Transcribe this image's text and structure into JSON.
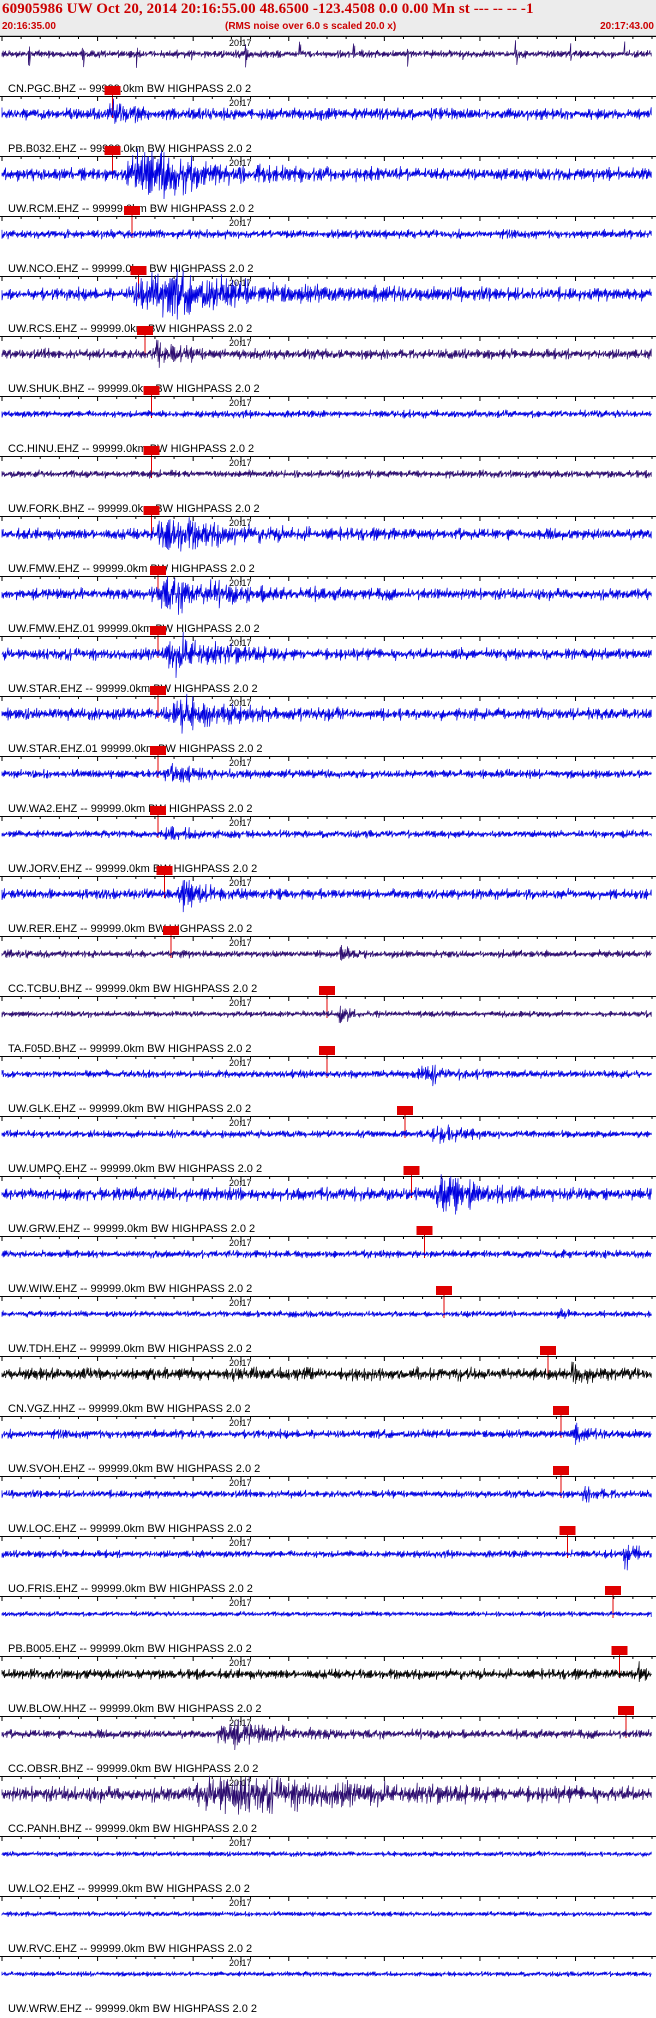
{
  "header": {
    "title": "60905986 UW Oct 20, 2014 20:16:55.00   48.6500 -123.4508  0.0 0.00 Mn st --- -- --  -1",
    "start_time": "20:16:35.00",
    "noise_note": "(RMS noise over 6.0 s scaled 20.0 x)",
    "end_time": "20:17:43.00"
  },
  "minute_label": "20:17",
  "colors": {
    "blue": "#0000e0",
    "purple": "#2a0a6e",
    "black": "#000000",
    "pick": "#e00000"
  },
  "traces": [
    {
      "label": "CN.PGC.BHZ -- 99999.0km BW  HIGHPASS  2.0  2",
      "color": "purple",
      "pick": 0.17,
      "amp": 0.3,
      "burst": null,
      "spikes": true
    },
    {
      "label": "PB.B032.EHZ -- 99999.0km BW  HIGHPASS  2.0  2",
      "color": "blue",
      "pick": 0.17,
      "amp": 0.45,
      "burst": [
        0.17,
        0.04,
        1.5
      ],
      "spikes": false
    },
    {
      "label": "UW.RCM.EHZ -- 99999.0km BW  HIGHPASS  2.0  2",
      "color": "blue",
      "pick": 0.2,
      "amp": 0.5,
      "burst": [
        0.22,
        0.1,
        4.0
      ],
      "spikes": false
    },
    {
      "label": "UW.NCO.EHZ -- 99999.0km BW  HIGHPASS  2.0  2",
      "color": "blue",
      "pick": 0.21,
      "amp": 0.35,
      "burst": null,
      "spikes": false
    },
    {
      "label": "UW.RCS.EHZ -- 99999.0km BW  HIGHPASS  2.0  2",
      "color": "blue",
      "pick": 0.22,
      "amp": 0.5,
      "burst": [
        0.24,
        0.15,
        3.5
      ],
      "spikes": false
    },
    {
      "label": "UW.SHUK.BHZ -- 99999.0km BW  HIGHPASS  2.0  2",
      "color": "purple",
      "pick": 0.23,
      "amp": 0.4,
      "burst": [
        0.24,
        0.04,
        2.0
      ],
      "spikes": false
    },
    {
      "label": "CC.HINU.EHZ -- 99999.0km BW  HIGHPASS  2.0  2",
      "color": "blue",
      "pick": 0.23,
      "amp": 0.3,
      "burst": null,
      "spikes": false
    },
    {
      "label": "UW.FORK.BHZ -- 99999.0km BW  HIGHPASS  2.0  2",
      "color": "purple",
      "pick": 0.23,
      "amp": 0.3,
      "burst": null,
      "spikes": false
    },
    {
      "label": "UW.FMW.EHZ -- 99999.0km BW  HIGHPASS  2.0  2",
      "color": "blue",
      "pick": 0.24,
      "amp": 0.45,
      "burst": [
        0.26,
        0.1,
        2.5
      ],
      "spikes": false
    },
    {
      "label": "UW.FMW.EHZ.01 99999.0km BW  HIGHPASS  2.0  2",
      "color": "blue",
      "pick": 0.24,
      "amp": 0.45,
      "burst": [
        0.26,
        0.1,
        2.5
      ],
      "spikes": false
    },
    {
      "label": "UW.STAR.EHZ -- 99999.0km BW  HIGHPASS  2.0  2",
      "color": "blue",
      "pick": 0.24,
      "amp": 0.45,
      "burst": [
        0.27,
        0.08,
        2.5
      ],
      "spikes": false
    },
    {
      "label": "UW.STAR.EHZ.01 99999.0km BW  HIGHPASS  2.0  2",
      "color": "blue",
      "pick": 0.24,
      "amp": 0.45,
      "burst": [
        0.27,
        0.08,
        2.5
      ],
      "spikes": false
    },
    {
      "label": "UW.WA2.EHZ -- 99999.0km BW  HIGHPASS  2.0  2",
      "color": "blue",
      "pick": 0.24,
      "amp": 0.35,
      "burst": [
        0.26,
        0.05,
        1.5
      ],
      "spikes": false
    },
    {
      "label": "UW.JORV.EHZ -- 99999.0km BW  HIGHPASS  2.0  2",
      "color": "blue",
      "pick": 0.25,
      "amp": 0.3,
      "burst": [
        0.26,
        0.06,
        1.2
      ],
      "spikes": false
    },
    {
      "label": "UW.RER.EHZ -- 99999.0km BW  HIGHPASS  2.0  2",
      "color": "blue",
      "pick": 0.26,
      "amp": 0.4,
      "burst": [
        0.28,
        0.04,
        2.5
      ],
      "spikes": false
    },
    {
      "label": "CC.TCBU.BHZ -- 99999.0km BW  HIGHPASS  2.0  2",
      "color": "purple",
      "pick": 0.5,
      "amp": 0.3,
      "burst": [
        0.52,
        0.02,
        1.5
      ],
      "spikes": false
    },
    {
      "label": "TA.F05D.BHZ -- 99999.0km BW  HIGHPASS  2.0  2",
      "color": "purple",
      "pick": 0.5,
      "amp": 0.25,
      "burst": [
        0.52,
        0.015,
        3.0
      ],
      "spikes": false
    },
    {
      "label": "UW.GLK.EHZ -- 99999.0km BW  HIGHPASS  2.0  2",
      "color": "blue",
      "pick": 0.62,
      "amp": 0.3,
      "burst": [
        0.65,
        0.04,
        2.5
      ],
      "spikes": false
    },
    {
      "label": "UW.UMPQ.EHZ -- 99999.0km BW  HIGHPASS  2.0  2",
      "color": "blue",
      "pick": 0.63,
      "amp": 0.3,
      "burst": [
        0.67,
        0.04,
        2.0
      ],
      "spikes": false
    },
    {
      "label": "UW.GRW.EHZ -- 99999.0km BW  HIGHPASS  2.0  2",
      "color": "blue",
      "pick": 0.65,
      "amp": 0.5,
      "burst": [
        0.68,
        0.06,
        3.5
      ],
      "spikes": false
    },
    {
      "label": "UW.WIW.EHZ -- 99999.0km BW  HIGHPASS  2.0  2",
      "color": "blue",
      "pick": 0.68,
      "amp": 0.3,
      "burst": null,
      "spikes": false
    },
    {
      "label": "UW.TDH.EHZ -- 99999.0km BW  HIGHPASS  2.0  2",
      "color": "blue",
      "pick": 0.84,
      "amp": 0.25,
      "burst": [
        0.86,
        0.02,
        1.2
      ],
      "spikes": false
    },
    {
      "label": "CN.VGZ.HHZ -- 99999.0km BW  HIGHPASS  2.0  2",
      "color": "black",
      "pick": 0.86,
      "amp": 0.5,
      "burst": [
        0.88,
        0.02,
        1.5
      ],
      "spikes": false
    },
    {
      "label": "UW.SVOH.EHZ -- 99999.0km BW  HIGHPASS  2.0  2",
      "color": "blue",
      "pick": 0.86,
      "amp": 0.35,
      "burst": [
        0.88,
        0.02,
        1.5
      ],
      "spikes": false
    },
    {
      "label": "UW.LOC.EHZ -- 99999.0km BW  HIGHPASS  2.0  2",
      "color": "blue",
      "pick": 0.87,
      "amp": 0.3,
      "burst": [
        0.9,
        0.03,
        1.5
      ],
      "spikes": false
    },
    {
      "label": "UO.FRIS.EHZ -- 99999.0km BW  HIGHPASS  2.0  2",
      "color": "blue",
      "pick": 0.94,
      "amp": 0.3,
      "burst": [
        0.96,
        0.02,
        3.0
      ],
      "spikes": false
    },
    {
      "label": "PB.B005.EHZ -- 99999.0km BW  HIGHPASS  2.0  2",
      "color": "blue",
      "pick": 0.95,
      "amp": 0.2,
      "burst": null,
      "spikes": false
    },
    {
      "label": "UW.BLOW.HHZ -- 99999.0km BW  HIGHPASS  2.0  2",
      "color": "black",
      "pick": 0.96,
      "amp": 0.4,
      "burst": [
        0.98,
        0.015,
        2.0
      ],
      "spikes": false
    },
    {
      "label": "CC.OBSR.BHZ -- 99999.0km BW  HIGHPASS  2.0  2",
      "color": "purple",
      "pick": null,
      "amp": 0.35,
      "burst": [
        0.35,
        0.08,
        2.5
      ],
      "spikes": false
    },
    {
      "label": "CC.PANH.BHZ -- 99999.0km BW  HIGHPASS  2.0  2",
      "color": "purple",
      "pick": null,
      "amp": 0.6,
      "burst": [
        0.35,
        0.2,
        1.8
      ],
      "spikes": false
    },
    {
      "label": "UW.LO2.EHZ -- 99999.0km BW  HIGHPASS  2.0  2",
      "color": "blue",
      "pick": null,
      "amp": 0.2,
      "burst": null,
      "spikes": false
    },
    {
      "label": "UW.RVC.EHZ -- 99999.0km BW  HIGHPASS  2.0  2",
      "color": "blue",
      "pick": null,
      "amp": 0.2,
      "burst": null,
      "spikes": false
    },
    {
      "label": "UW.WRW.EHZ -- 99999.0km BW  HIGHPASS  2.0  2",
      "color": "blue",
      "pick": null,
      "amp": 0.2,
      "burst": null,
      "spikes": false
    }
  ]
}
